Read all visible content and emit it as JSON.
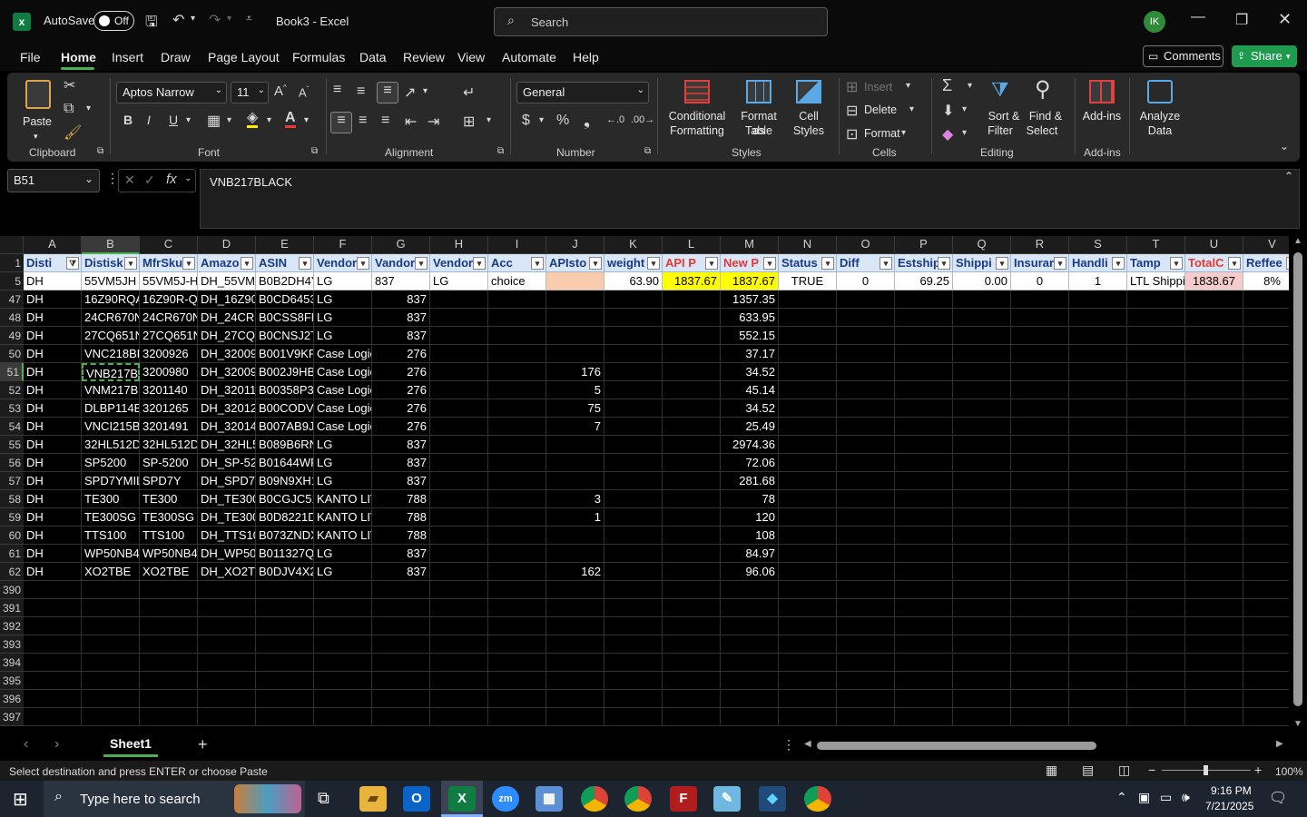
{
  "titlebar": {
    "autosave": "AutoSave",
    "toggle": "Off",
    "title": "Book3 - Excel",
    "search_placeholder": "Search",
    "avatar": "IK"
  },
  "menu": {
    "items": [
      "File",
      "Home",
      "Insert",
      "Draw",
      "Page Layout",
      "Formulas",
      "Data",
      "Review",
      "View",
      "Automate",
      "Help"
    ],
    "comments": "Comments",
    "share": "Share"
  },
  "ribbon": {
    "clipboard": {
      "paste": "Paste",
      "group": "Clipboard"
    },
    "font": {
      "name": "Aptos Narrow",
      "size": "11",
      "group": "Font"
    },
    "alignment": {
      "group": "Alignment"
    },
    "number": {
      "format": "General",
      "group": "Number"
    },
    "styles": {
      "conditional": "Conditional",
      "formatting": "Formatting",
      "format_as": "Format as",
      "table": "Table",
      "cell": "Cell",
      "styles": "Styles",
      "group": "Styles"
    },
    "cells": {
      "insert": "Insert",
      "delete": "Delete",
      "format": "Format",
      "group": "Cells"
    },
    "editing": {
      "sort": "Sort &",
      "filter": "Filter",
      "find": "Find &",
      "select": "Select",
      "group": "Editing"
    },
    "addins": {
      "label": "Add-ins",
      "group": "Add-ins"
    },
    "analyze": {
      "l1": "Analyze",
      "l2": "Data"
    }
  },
  "formula": {
    "namebox": "B51",
    "value": "VNB217BLACK"
  },
  "columns": [
    "A",
    "B",
    "C",
    "D",
    "E",
    "F",
    "G",
    "H",
    "I",
    "J",
    "K",
    "L",
    "M",
    "N",
    "O",
    "P",
    "Q",
    "R",
    "S",
    "T",
    "U",
    "V"
  ],
  "headers": [
    "Disti",
    "Distisk",
    "MfrSku",
    "Amazo",
    "ASIN",
    "Vendor",
    "Vandor",
    "Vendor",
    "Acc",
    "APIsto",
    "weight",
    "API P",
    "New P",
    "Status",
    "Diff",
    "Estship",
    "Shippi",
    "Insurar",
    "Handli",
    "Tamp",
    "TotalC",
    "Reffee"
  ],
  "row5": [
    "DH",
    "55VM5JH",
    "55VM5J-H",
    "DH_55VM5",
    "B0B2DH4Y",
    "LG",
    "837",
    "LG",
    "choice",
    "",
    "63.90",
    "1837.67",
    "1837.67",
    "TRUE",
    "0",
    "69.25",
    "0.00",
    "0",
    "1",
    "LTL Shippi",
    "1838.67",
    "8%"
  ],
  "rows": [
    [
      "47",
      "DH",
      "16Z90RQA",
      "16Z90R-Q.",
      "DH_16Z90",
      "B0CD6453",
      "LG",
      "837",
      "",
      "",
      "",
      "",
      "",
      "1357.35"
    ],
    [
      "48",
      "DH",
      "24CR670N",
      "24CR670N",
      "DH_24CR6",
      "B0CSS8FM",
      "LG",
      "837",
      "",
      "",
      "",
      "",
      "",
      "633.95"
    ],
    [
      "49",
      "DH",
      "27CQ651N",
      "27CQ651N",
      "DH_27CQ6",
      "B0CNSJ2T",
      "LG",
      "837",
      "",
      "",
      "",
      "",
      "",
      "552.15"
    ],
    [
      "50",
      "DH",
      "VNC218BL",
      "3200926",
      "DH_32009",
      "B001V9KF",
      "Case Logic",
      "276",
      "",
      "",
      "",
      "",
      "",
      "37.17"
    ],
    [
      "51",
      "DH",
      "VNB217BL",
      "3200980",
      "DH_32009",
      "B002J9HB",
      "Case Logic",
      "276",
      "",
      "",
      "176",
      "",
      "",
      "34.52"
    ],
    [
      "52",
      "DH",
      "VNM217BL",
      "3201140",
      "DH_32011",
      "B00358P3",
      "Case Logic",
      "276",
      "",
      "",
      "5",
      "",
      "",
      "45.14"
    ],
    [
      "53",
      "DH",
      "DLBP114B",
      "3201265",
      "DH_32012",
      "B00CODVT",
      "Case Logic",
      "276",
      "",
      "",
      "75",
      "",
      "",
      "34.52"
    ],
    [
      "54",
      "DH",
      "VNCI215B",
      "3201491",
      "DH_32014",
      "B007AB9J",
      "Case Logic",
      "276",
      "",
      "",
      "7",
      "",
      "",
      "25.49"
    ],
    [
      "55",
      "DH",
      "32HL512D",
      "32HL512D-",
      "DH_32HL5",
      "B089B6RN",
      "LG",
      "837",
      "",
      "",
      "",
      "",
      "",
      "2974.36"
    ],
    [
      "56",
      "DH",
      "SP5200",
      "SP-5200",
      "DH_SP-52",
      "B01644WF",
      "LG",
      "837",
      "",
      "",
      "",
      "",
      "",
      "72.06"
    ],
    [
      "57",
      "DH",
      "SPD7YMIL",
      "SPD7Y",
      "DH_SPD7Y",
      "B09N9XH1",
      "LG",
      "837",
      "",
      "",
      "",
      "",
      "",
      "281.68"
    ],
    [
      "58",
      "DH",
      "TE300",
      "TE300",
      "DH_TE300",
      "B0CGJC51",
      "KANTO LIV",
      "788",
      "",
      "",
      "3",
      "",
      "",
      "78"
    ],
    [
      "59",
      "DH",
      "TE300SG",
      "TE300SG",
      "DH_TE300",
      "B0D8221D",
      "KANTO LIV",
      "788",
      "",
      "",
      "1",
      "",
      "",
      "120"
    ],
    [
      "60",
      "DH",
      "TTS100",
      "TTS100",
      "DH_TTS10",
      "B073ZNDX",
      "KANTO LIV",
      "788",
      "",
      "",
      "",
      "",
      "",
      "108"
    ],
    [
      "61",
      "DH",
      "WP50NB4",
      "WP50NB4",
      "DH_WP50I",
      "B011327Q",
      "LG",
      "837",
      "",
      "",
      "",
      "",
      "",
      "84.97"
    ],
    [
      "62",
      "DH",
      "XO2TBE",
      "XO2TBE",
      "DH_XO2TE",
      "B0DJV4X2",
      "LG",
      "837",
      "",
      "",
      "162",
      "",
      "",
      "96.06"
    ]
  ],
  "empty_rows": [
    "390",
    "391",
    "392",
    "393",
    "394",
    "395",
    "396",
    "397"
  ],
  "sheet": {
    "tab": "Sheet1"
  },
  "status": {
    "message": "Select destination and press ENTER or choose Paste",
    "zoom": "100%"
  },
  "taskbar": {
    "search": "Type here to search",
    "time": "9:16 PM",
    "date": "7/21/2025"
  },
  "colors": {
    "header_fill": "#d8e6f5",
    "yellow": "#ffff00",
    "pink": "#f4cccc",
    "orange": "#f8cbad",
    "excel_green": "#107c41",
    "share_green": "#1f9b4f"
  }
}
